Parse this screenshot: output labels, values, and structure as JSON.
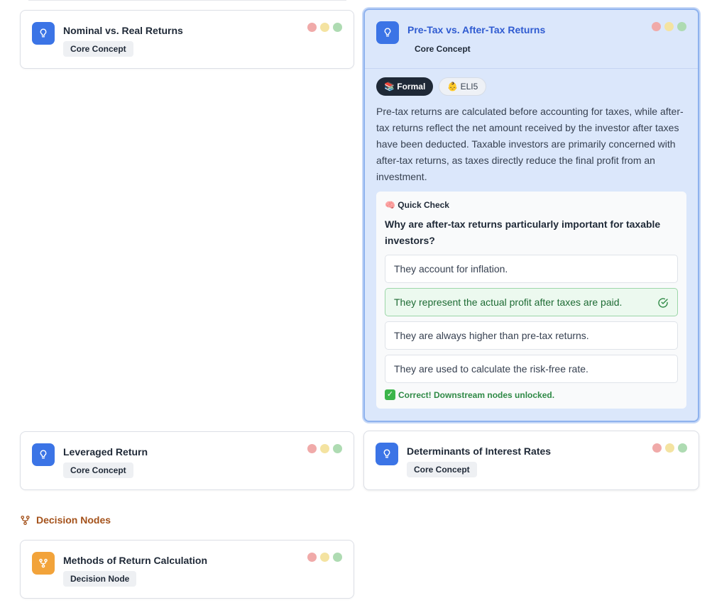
{
  "cards": [
    {
      "title": "Nominal vs. Real Returns",
      "badge": "Core Concept"
    },
    {
      "title": "Leveraged Return",
      "badge": "Core Concept"
    },
    {
      "title": "Determinants of Interest Rates",
      "badge": "Core Concept"
    },
    {
      "title": "Methods of Return Calculation",
      "badge": "Decision Node"
    }
  ],
  "active_card": {
    "title": "Pre-Tax vs. After-Tax Returns",
    "badge": "Core Concept",
    "toggles": {
      "formal": "📚 Formal",
      "eli5": "👶 ELI5"
    },
    "explanation": "Pre-tax returns are calculated before accounting for taxes, while after-tax returns reflect the net amount received by the investor after taxes have been deducted. Taxable investors are primarily concerned with after-tax returns, as taxes directly reduce the final profit from an investment.",
    "quiz": {
      "heading": "🧠 Quick Check",
      "question": "Why are after-tax returns particularly important for taxable investors?",
      "options": [
        "They account for inflation.",
        "They represent the actual profit after taxes are paid.",
        "They are always higher than pre-tax returns.",
        "They are used to calculate the risk-free rate."
      ],
      "correct_index": 1,
      "feedback": "Correct! Downstream nodes unlocked.",
      "feedback_emoji": "✓"
    }
  },
  "section": {
    "label": "Decision Nodes"
  },
  "colors": {
    "core_icon": "#3b74e6",
    "decision_icon": "#f2a33a",
    "active_bg": "#dbe7fb",
    "active_title": "#2f5bd1",
    "section_label": "#a4521b",
    "correct": "#2f8a46"
  },
  "icons": {
    "core": "lightbulb-icon",
    "decision": "branch-icon",
    "correct": "check-circle-icon"
  }
}
